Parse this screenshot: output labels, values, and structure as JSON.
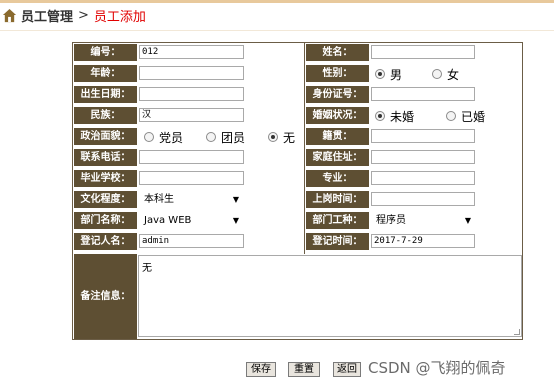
{
  "breadcrumb": {
    "section": "员工管理",
    "separator": ">",
    "current": "员工添加"
  },
  "labels": {
    "emp_no": "编号：",
    "name": "姓名：",
    "age": "年龄：",
    "gender": "性别：",
    "birthdate": "出生日期：",
    "id_card": "身份证号：",
    "ethnicity": "民族：",
    "marital": "婚姻状况：",
    "political": "政治面貌：",
    "native": "籍贯：",
    "phone": "联系电话：",
    "address": "家庭住址：",
    "school": "毕业学校：",
    "major": "专业：",
    "education": "文化程度：",
    "hire_time": "上岗时间：",
    "department": "部门名称：",
    "job_type": "部门工种：",
    "registrar": "登记人名：",
    "register_time": "登记时间：",
    "remarks": "备注信息："
  },
  "values": {
    "emp_no": "012",
    "name": "",
    "age": "",
    "birthdate": "",
    "id_card": "",
    "ethnicity": "汉",
    "native": "",
    "phone": "",
    "address": "",
    "school": "",
    "major": "",
    "hire_time": "",
    "registrar": "admin",
    "register_time": "2017-7-29",
    "remarks": "无"
  },
  "radios": {
    "gender": [
      {
        "label": "男",
        "checked": true
      },
      {
        "label": "女",
        "checked": false
      }
    ],
    "marital": [
      {
        "label": "未婚",
        "checked": true
      },
      {
        "label": "已婚",
        "checked": false
      }
    ],
    "political": [
      {
        "label": "党员",
        "checked": false
      },
      {
        "label": "团员",
        "checked": false
      },
      {
        "label": "无",
        "checked": true
      }
    ]
  },
  "selects": {
    "education": "本科生",
    "department": "Java WEB",
    "job_type": "程序员",
    "arrow": "▼"
  },
  "buttons": {
    "save": "保存",
    "reset": "重置",
    "back": "返回"
  },
  "watermark": "CSDN @飞翔的佩奇",
  "colors": {
    "label_bg": "#5e4f33",
    "crumb_current": "#e10000"
  }
}
